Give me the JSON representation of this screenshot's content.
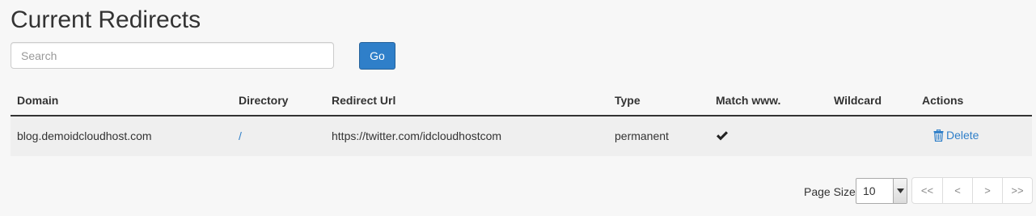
{
  "page": {
    "title": "Current Redirects"
  },
  "search": {
    "placeholder": "Search",
    "value": "",
    "go_label": "Go"
  },
  "table": {
    "columns": [
      "Domain",
      "Directory",
      "Redirect Url",
      "Type",
      "Match www.",
      "Wildcard",
      "Actions"
    ],
    "rows": [
      {
        "domain": "blog.demoidcloudhost.com",
        "directory": "/",
        "redirect_url": "https://twitter.com/idcloudhostcom",
        "type": "permanent",
        "match_www": true,
        "wildcard": false,
        "action_label": "Delete"
      }
    ]
  },
  "pagination": {
    "page_size_label": "Page Size",
    "page_size_value": "10",
    "buttons": [
      "<<",
      "<",
      ">",
      ">>"
    ]
  },
  "colors": {
    "accent": "#2f7fc9",
    "background": "#f7f7f7",
    "row_background": "#efefef"
  },
  "icons": {
    "match_www": "check-icon",
    "delete": "trash-icon",
    "select": "chevron-down-icon"
  }
}
